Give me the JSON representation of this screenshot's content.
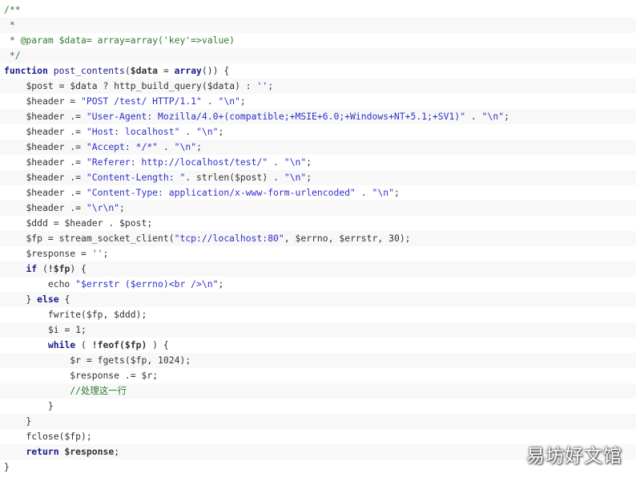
{
  "code": {
    "language": "php",
    "lines": [
      [
        [
          "cm",
          "/**"
        ]
      ],
      [
        [
          "cm",
          " *"
        ]
      ],
      [
        [
          "cm",
          " * @param $data= array=array('key'=>value)"
        ]
      ],
      [
        [
          "cm",
          " */"
        ]
      ],
      [
        [
          "kw",
          "function"
        ],
        [
          "op",
          " "
        ],
        [
          "fn",
          "post_contents"
        ],
        [
          "op",
          "("
        ],
        [
          "vb",
          "$data"
        ],
        [
          "op",
          " = "
        ],
        [
          "fnb",
          "array"
        ],
        [
          "op",
          "()) {"
        ]
      ],
      [
        [
          "op",
          "    "
        ],
        [
          "vr",
          "$post"
        ],
        [
          "op",
          " = "
        ],
        [
          "vr",
          "$data"
        ],
        [
          "op",
          " ? http_build_query("
        ],
        [
          "vr",
          "$data"
        ],
        [
          "op",
          ") : "
        ],
        [
          "st",
          "''"
        ],
        [
          "op",
          ";"
        ]
      ],
      [
        [
          "op",
          "    "
        ],
        [
          "vr",
          "$header"
        ],
        [
          "op",
          " = "
        ],
        [
          "st",
          "\"POST /test/ HTTP/1.1\""
        ],
        [
          "op",
          " . "
        ],
        [
          "st",
          "\"\\n\""
        ],
        [
          "op",
          ";"
        ]
      ],
      [
        [
          "op",
          "    "
        ],
        [
          "vr",
          "$header"
        ],
        [
          "op",
          " .= "
        ],
        [
          "st",
          "\"User-Agent: Mozilla/4.0+(compatible;+MSIE+6.0;+Windows+NT+5.1;+SV1)\""
        ],
        [
          "op",
          " . "
        ],
        [
          "st",
          "\"\\n\""
        ],
        [
          "op",
          ";"
        ]
      ],
      [
        [
          "op",
          "    "
        ],
        [
          "vr",
          "$header"
        ],
        [
          "op",
          " .= "
        ],
        [
          "st",
          "\"Host: localhost\""
        ],
        [
          "op",
          " . "
        ],
        [
          "st",
          "\"\\n\""
        ],
        [
          "op",
          ";"
        ]
      ],
      [
        [
          "op",
          "    "
        ],
        [
          "vr",
          "$header"
        ],
        [
          "op",
          " .= "
        ],
        [
          "st",
          "\"Accept: */*\""
        ],
        [
          "op",
          " . "
        ],
        [
          "st",
          "\"\\n\""
        ],
        [
          "op",
          ";"
        ]
      ],
      [
        [
          "op",
          "    "
        ],
        [
          "vr",
          "$header"
        ],
        [
          "op",
          " .= "
        ],
        [
          "st",
          "\"Referer: http://localhost/test/\""
        ],
        [
          "op",
          " . "
        ],
        [
          "st",
          "\"\\n\""
        ],
        [
          "op",
          ";"
        ]
      ],
      [
        [
          "op",
          "    "
        ],
        [
          "vr",
          "$header"
        ],
        [
          "op",
          " .= "
        ],
        [
          "st",
          "\"Content-Length: \""
        ],
        [
          "op",
          ". strlen("
        ],
        [
          "vr",
          "$post"
        ],
        [
          "op",
          ") . "
        ],
        [
          "st",
          "\"\\n\""
        ],
        [
          "op",
          ";"
        ]
      ],
      [
        [
          "op",
          "    "
        ],
        [
          "vr",
          "$header"
        ],
        [
          "op",
          " .= "
        ],
        [
          "st",
          "\"Content-Type: application/x-www-form-urlencoded\""
        ],
        [
          "op",
          " . "
        ],
        [
          "st",
          "\"\\n\""
        ],
        [
          "op",
          ";"
        ]
      ],
      [
        [
          "op",
          "    "
        ],
        [
          "vr",
          "$header"
        ],
        [
          "op",
          " .= "
        ],
        [
          "st",
          "\"\\r\\n\""
        ],
        [
          "op",
          ";"
        ]
      ],
      [
        [
          "op",
          "    "
        ],
        [
          "vr",
          "$ddd"
        ],
        [
          "op",
          " = "
        ],
        [
          "vr",
          "$header"
        ],
        [
          "op",
          " . "
        ],
        [
          "vr",
          "$post"
        ],
        [
          "op",
          ";"
        ]
      ],
      [
        [
          "op",
          "    "
        ],
        [
          "vr",
          "$fp"
        ],
        [
          "op",
          " = stream_socket_client("
        ],
        [
          "st",
          "\"tcp://localhost:80\""
        ],
        [
          "op",
          ", "
        ],
        [
          "vr",
          "$errno"
        ],
        [
          "op",
          ", "
        ],
        [
          "vr",
          "$errstr"
        ],
        [
          "op",
          ", "
        ],
        [
          "nm",
          "30"
        ],
        [
          "op",
          ");"
        ]
      ],
      [
        [
          "op",
          "    "
        ],
        [
          "vr",
          "$response"
        ],
        [
          "op",
          " = "
        ],
        [
          "st",
          "''"
        ],
        [
          "op",
          ";"
        ]
      ],
      [
        [
          "op",
          "    "
        ],
        [
          "kw",
          "if"
        ],
        [
          "op",
          " ("
        ],
        [
          "vb",
          "!$fp"
        ],
        [
          "op",
          ") {"
        ]
      ],
      [
        [
          "op",
          "        echo "
        ],
        [
          "st",
          "\"$errstr ($errno)<br />\\n\""
        ],
        [
          "op",
          ";"
        ]
      ],
      [
        [
          "op",
          "    } "
        ],
        [
          "kw",
          "else"
        ],
        [
          "op",
          " {"
        ]
      ],
      [
        [
          "op",
          "        fwrite("
        ],
        [
          "vr",
          "$fp"
        ],
        [
          "op",
          ", "
        ],
        [
          "vr",
          "$ddd"
        ],
        [
          "op",
          ");"
        ]
      ],
      [
        [
          "op",
          "        "
        ],
        [
          "vr",
          "$i"
        ],
        [
          "op",
          " = "
        ],
        [
          "nm",
          "1"
        ],
        [
          "op",
          ";"
        ]
      ],
      [
        [
          "op",
          "        "
        ],
        [
          "kw",
          "while"
        ],
        [
          "op",
          " ( "
        ],
        [
          "vb",
          "!feof($fp)"
        ],
        [
          "op",
          " ) {"
        ]
      ],
      [
        [
          "op",
          "            "
        ],
        [
          "vr",
          "$r"
        ],
        [
          "op",
          " = fgets("
        ],
        [
          "vr",
          "$fp"
        ],
        [
          "op",
          ", "
        ],
        [
          "nm",
          "1024"
        ],
        [
          "op",
          ");"
        ]
      ],
      [
        [
          "op",
          "            "
        ],
        [
          "vr",
          "$response"
        ],
        [
          "op",
          " .= "
        ],
        [
          "vr",
          "$r"
        ],
        [
          "op",
          ";"
        ]
      ],
      [
        [
          "op",
          "            "
        ],
        [
          "cm",
          "//处理这一行"
        ]
      ],
      [
        [
          "op",
          "        }"
        ]
      ],
      [
        [
          "op",
          "    }"
        ]
      ],
      [
        [
          "op",
          "    fclose("
        ],
        [
          "vr",
          "$fp"
        ],
        [
          "op",
          ");"
        ]
      ],
      [
        [
          "op",
          "    "
        ],
        [
          "kw",
          "return"
        ],
        [
          "op",
          " "
        ],
        [
          "vb",
          "$response"
        ],
        [
          "op",
          ";"
        ]
      ],
      [
        [
          "op",
          "}"
        ]
      ]
    ]
  },
  "watermark": {
    "text": "易坊好文馆"
  },
  "colors": {
    "comment": "#2a7a2a",
    "keyword": "#1a1a8c",
    "string": "#3030c8",
    "text": "#333333",
    "alt_row": "#f8f8f8"
  }
}
